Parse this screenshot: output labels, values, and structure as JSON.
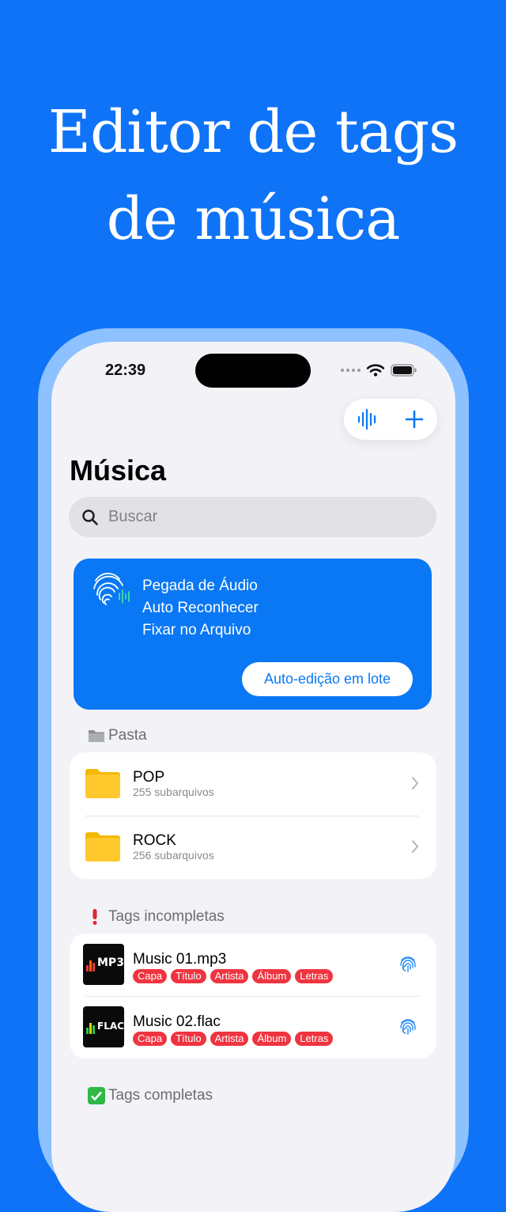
{
  "hero": {
    "line1": "Editor de tags",
    "line2": "de música"
  },
  "status_bar": {
    "time": "22:39"
  },
  "page_title": "Música",
  "search": {
    "placeholder": "Buscar"
  },
  "banner": {
    "features": [
      "Pegada de Áudio",
      "Auto Reconhecer",
      "Fixar no Arquivo"
    ],
    "button_label": "Auto-edição em lote"
  },
  "folders": {
    "label": "Pasta",
    "items": [
      {
        "name": "POP",
        "count": "255 subarquivos"
      },
      {
        "name": "ROCK",
        "count": "256 subarquivos"
      }
    ]
  },
  "incomplete": {
    "label": "Tags incompletas",
    "items": [
      {
        "name": "Music 01.mp3",
        "thumb": "MP3",
        "tags": [
          "Capa",
          "Título",
          "Artista",
          "Álbum",
          "Letras"
        ]
      },
      {
        "name": "Music 02.flac",
        "thumb": "FLAC",
        "tags": [
          "Capa",
          "Título",
          "Artista",
          "Álbum",
          "Letras"
        ]
      }
    ]
  },
  "complete": {
    "label": "Tags completas"
  },
  "section_index": [
    "folder-icon",
    "exclamation-icon",
    "check-icon"
  ],
  "colors": {
    "background": "#0f73f7",
    "accent": "#0a78f4",
    "tag_red": "#ef3440",
    "folder_yellow": "#ffc82c"
  }
}
